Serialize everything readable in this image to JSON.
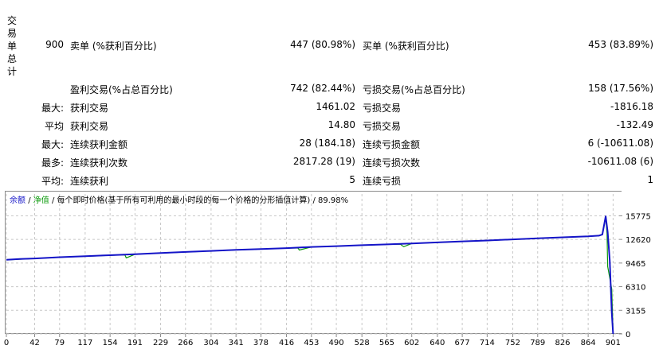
{
  "vertical_title": [
    "交",
    "易",
    "单",
    "总",
    "计"
  ],
  "total": {
    "value": "900",
    "short_label": "卖单 (%获利百分比)",
    "short_value": "447 (80.98%)",
    "long_label": "买单 (%获利百分比)",
    "long_value": "453 (83.89%)"
  },
  "rows": [
    {
      "prefix": "",
      "left_label": "盈利交易(%占总百分比)",
      "left_value": "742 (82.44%)",
      "right_label": "亏损交易(%占总百分比)",
      "right_value": "158 (17.56%)"
    },
    {
      "prefix": "最大:",
      "left_label": "获利交易",
      "left_value": "1461.02",
      "right_label": "亏损交易",
      "right_value": "-1816.18"
    },
    {
      "prefix": "平均",
      "left_label": "获利交易",
      "left_value": "14.80",
      "right_label": "亏损交易",
      "right_value": "-132.49"
    },
    {
      "prefix": "最大:",
      "left_label": "连续获利金额",
      "left_value": "28 (184.18)",
      "right_label": "连续亏损金额",
      "right_value": "6 (-10611.08)"
    },
    {
      "prefix": "最多:",
      "left_label": "连续获利次数",
      "left_value": "2817.28 (19)",
      "right_label": "连续亏损次数",
      "right_value": "-10611.08 (6)"
    },
    {
      "prefix": "平均:",
      "left_label": "连续获利",
      "left_value": "5",
      "right_label": "连续亏损",
      "right_value": "1"
    }
  ],
  "legend": {
    "balance": "余额",
    "separator": "/",
    "equity": "净值",
    "description": "/ 每个即时价格(基于所有可利用的最小时段的每一个价格的分形插值计算) / 89.98%"
  },
  "colors": {
    "balance": "#1414c8",
    "equity": "#0a9a0a",
    "grid": "#c8c8c8",
    "axis": "#8c8c8c"
  },
  "chart_data": {
    "type": "line",
    "title": "",
    "xlabel": "",
    "ylabel": "",
    "x_ticks": [
      0,
      42,
      79,
      117,
      154,
      191,
      229,
      266,
      304,
      341,
      378,
      416,
      453,
      490,
      528,
      565,
      602,
      640,
      677,
      714,
      752,
      789,
      826,
      864,
      901
    ],
    "y_ticks": [
      0,
      3155,
      6310,
      9465,
      12620,
      15775
    ],
    "xlim": [
      0,
      910
    ],
    "ylim": [
      0,
      17200
    ],
    "grid": true,
    "legend_position": "top-left",
    "series": [
      {
        "name": "余额",
        "x": [
          0,
          20,
          42,
          79,
          117,
          154,
          191,
          229,
          266,
          304,
          341,
          378,
          416,
          453,
          490,
          528,
          565,
          602,
          640,
          677,
          714,
          752,
          789,
          826,
          864,
          880,
          885,
          890,
          893,
          896,
          899,
          901
        ],
        "values": [
          9900,
          10000,
          10080,
          10250,
          10380,
          10510,
          10650,
          10800,
          10950,
          11080,
          11220,
          11340,
          11460,
          11610,
          11720,
          11850,
          11960,
          12080,
          12220,
          12360,
          12480,
          12620,
          12760,
          12900,
          13030,
          13120,
          13280,
          15700,
          13600,
          9800,
          2900,
          0
        ]
      },
      {
        "name": "净值",
        "x": [
          0,
          42,
          79,
          117,
          154,
          176,
          178,
          191,
          229,
          266,
          304,
          341,
          378,
          416,
          433,
          435,
          453,
          490,
          528,
          565,
          585,
          590,
          602,
          640,
          677,
          714,
          752,
          789,
          826,
          864,
          880,
          885,
          890,
          892,
          893,
          899,
          901
        ],
        "values": [
          9880,
          10060,
          10230,
          10360,
          10490,
          10560,
          10150,
          10640,
          10790,
          10940,
          11070,
          11210,
          11330,
          11450,
          11480,
          11200,
          11600,
          11710,
          11840,
          11950,
          11980,
          11650,
          12070,
          12210,
          12350,
          12470,
          12610,
          12750,
          12890,
          13020,
          13110,
          13260,
          15650,
          13400,
          9000,
          6000,
          0
        ]
      }
    ]
  }
}
